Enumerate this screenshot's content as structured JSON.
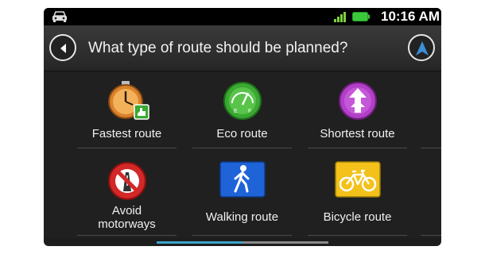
{
  "status_bar": {
    "time": "10:16 AM",
    "icons": [
      "car-icon",
      "signal-icon",
      "battery-icon"
    ],
    "signal_color": "#7bd13a",
    "battery_color": "#39c93a"
  },
  "header": {
    "title": "What type of route should be planned?",
    "back_icon": "back-arrow-icon",
    "nav_icon": "navigation-arrow-icon",
    "nav_color": "#3a8fd9"
  },
  "routes": [
    {
      "label": "Fastest route",
      "icon": "stopwatch-icon",
      "color": "#d9822b"
    },
    {
      "label": "Eco route",
      "icon": "eco-gauge-icon",
      "color": "#3aa832"
    },
    {
      "label": "Shortest route",
      "icon": "shortest-route-icon",
      "color": "#b23fc7"
    },
    {
      "label_line1": "Avoid",
      "label_line2": "motorways",
      "icon": "no-motorway-icon",
      "color": "#d22828"
    },
    {
      "label": "Walking route",
      "icon": "pedestrian-icon",
      "color": "#1f63d8"
    },
    {
      "label": "Bicycle route",
      "icon": "bicycle-icon",
      "color": "#f3c11a"
    }
  ],
  "scroll": {
    "position_fraction": 0.5
  }
}
